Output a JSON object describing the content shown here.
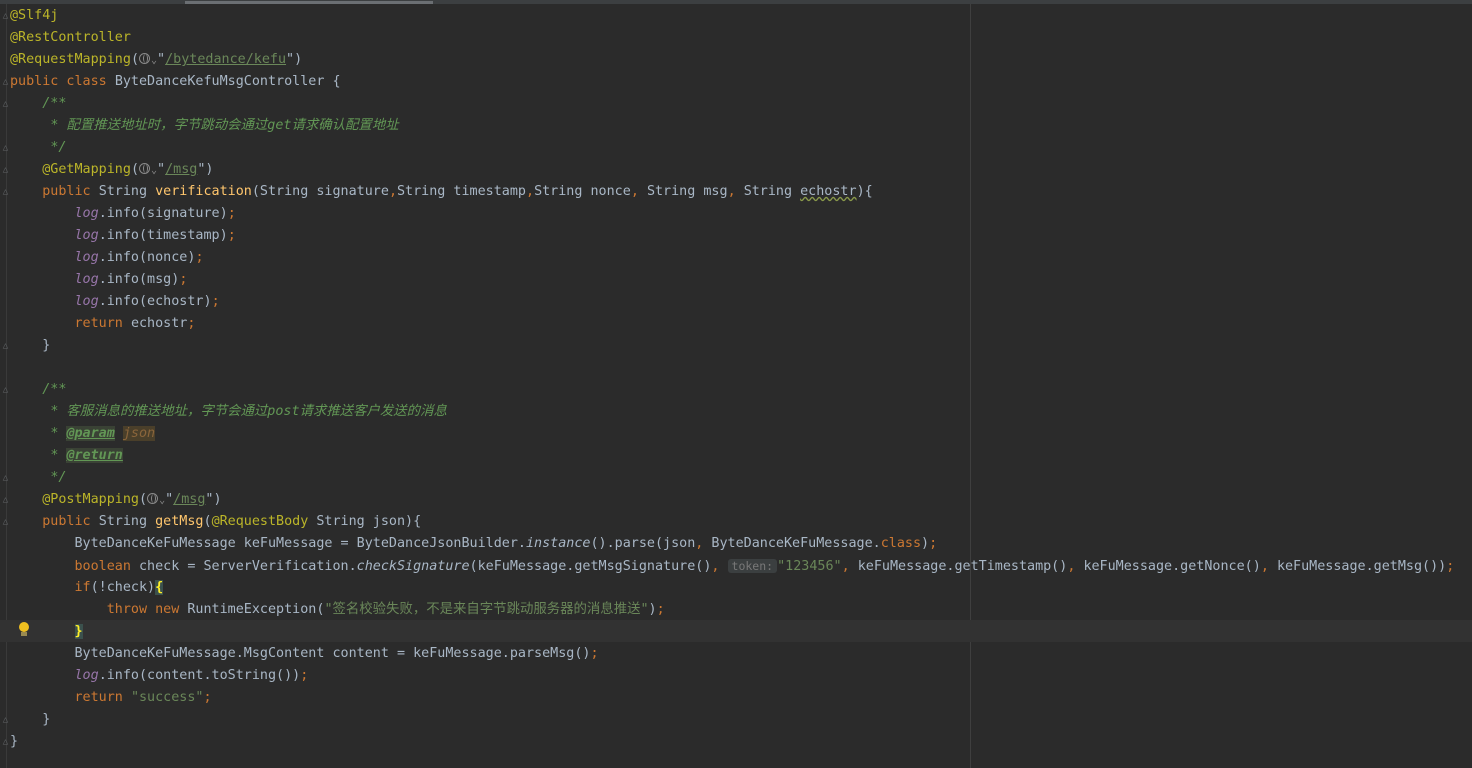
{
  "editor": {
    "lines": [
      [
        {
          "t": "@Slf4j",
          "c": "ann"
        }
      ],
      [
        {
          "t": "@RestController",
          "c": "ann"
        }
      ],
      [
        {
          "t": "@RequestMapping",
          "c": "ann"
        },
        {
          "t": "("
        },
        {
          "icon": "globe-icon"
        },
        {
          "t": "\""
        },
        {
          "t": "/bytedance/kefu",
          "c": "str url"
        },
        {
          "t": "\")"
        }
      ],
      [
        {
          "t": "public class ",
          "c": "kw"
        },
        {
          "t": "ByteDanceKefuMsgController {"
        }
      ],
      [
        {
          "t": "    "
        },
        {
          "t": "/**",
          "c": "doc"
        }
      ],
      [
        {
          "t": "     "
        },
        {
          "t": "* 配置推送地址时，字节跳动会通过",
          "c": "doc"
        },
        {
          "t": "get",
          "c": "doc"
        },
        {
          "t": "请求确认配置地址",
          "c": "doc"
        }
      ],
      [
        {
          "t": "     "
        },
        {
          "t": "*/",
          "c": "doc"
        }
      ],
      [
        {
          "t": "    "
        },
        {
          "t": "@GetMapping",
          "c": "ann"
        },
        {
          "t": "("
        },
        {
          "icon": "globe-icon"
        },
        {
          "t": "\""
        },
        {
          "t": "/msg",
          "c": "str url"
        },
        {
          "t": "\")"
        }
      ],
      [
        {
          "t": "    "
        },
        {
          "t": "public ",
          "c": "kw"
        },
        {
          "t": "String "
        },
        {
          "t": "verification",
          "c": "fn"
        },
        {
          "t": "(String signature"
        },
        {
          "t": ",",
          "c": "kw"
        },
        {
          "t": "String timestamp"
        },
        {
          "t": ",",
          "c": "kw"
        },
        {
          "t": "String nonce"
        },
        {
          "t": ", ",
          "c": "kw"
        },
        {
          "t": "String msg"
        },
        {
          "t": ", ",
          "c": "kw"
        },
        {
          "t": "String "
        },
        {
          "t": "echostr",
          "c": "squig"
        },
        {
          "t": "){"
        }
      ],
      [
        {
          "t": "        "
        },
        {
          "t": "log",
          "c": "field"
        },
        {
          "t": ".info(signature)"
        },
        {
          "t": ";",
          "c": "kw"
        }
      ],
      [
        {
          "t": "        "
        },
        {
          "t": "log",
          "c": "field"
        },
        {
          "t": ".info(timestamp)"
        },
        {
          "t": ";",
          "c": "kw"
        }
      ],
      [
        {
          "t": "        "
        },
        {
          "t": "log",
          "c": "field"
        },
        {
          "t": ".info(nonce)"
        },
        {
          "t": ";",
          "c": "kw"
        }
      ],
      [
        {
          "t": "        "
        },
        {
          "t": "log",
          "c": "field"
        },
        {
          "t": ".info(msg)"
        },
        {
          "t": ";",
          "c": "kw"
        }
      ],
      [
        {
          "t": "        "
        },
        {
          "t": "log",
          "c": "field"
        },
        {
          "t": ".info(echostr)"
        },
        {
          "t": ";",
          "c": "kw"
        }
      ],
      [
        {
          "t": "        "
        },
        {
          "t": "return ",
          "c": "kw"
        },
        {
          "t": "echostr"
        },
        {
          "t": ";",
          "c": "kw"
        }
      ],
      [
        {
          "t": "    }"
        }
      ],
      [],
      [
        {
          "t": "    "
        },
        {
          "t": "/**",
          "c": "doc"
        }
      ],
      [
        {
          "t": "     "
        },
        {
          "t": "* 客服消息的推送地址，字节会通过",
          "c": "doc"
        },
        {
          "t": "post",
          "c": "doc"
        },
        {
          "t": "请求推送客户发送的消息",
          "c": "doc"
        }
      ],
      [
        {
          "t": "     "
        },
        {
          "t": "* ",
          "c": "doc"
        },
        {
          "t": "@param",
          "c": "doctag"
        },
        {
          "t": " "
        },
        {
          "t": "json",
          "c": "docparam"
        }
      ],
      [
        {
          "t": "     "
        },
        {
          "t": "* ",
          "c": "doc"
        },
        {
          "t": "@return",
          "c": "doctag"
        }
      ],
      [
        {
          "t": "     "
        },
        {
          "t": "*/",
          "c": "doc"
        }
      ],
      [
        {
          "t": "    "
        },
        {
          "t": "@PostMapping",
          "c": "ann"
        },
        {
          "t": "("
        },
        {
          "icon": "globe-icon"
        },
        {
          "t": "\""
        },
        {
          "t": "/msg",
          "c": "str url"
        },
        {
          "t": "\")"
        }
      ],
      [
        {
          "t": "    "
        },
        {
          "t": "public ",
          "c": "kw"
        },
        {
          "t": "String "
        },
        {
          "t": "getMsg",
          "c": "fn"
        },
        {
          "t": "("
        },
        {
          "t": "@RequestBody ",
          "c": "ann"
        },
        {
          "t": "String json){"
        }
      ],
      [
        {
          "t": "        ByteDanceKeFuMessage keFuMessage = ByteDanceJsonBuilder."
        },
        {
          "t": "instance",
          "c": "italic"
        },
        {
          "t": "().parse(json"
        },
        {
          "t": ", ",
          "c": "kw"
        },
        {
          "t": "ByteDanceKeFuMessage."
        },
        {
          "t": "class",
          "c": "kw"
        },
        {
          "t": ")"
        },
        {
          "t": ";",
          "c": "kw"
        }
      ],
      [
        {
          "t": "        "
        },
        {
          "t": "boolean ",
          "c": "kw"
        },
        {
          "t": "check = ServerVerification."
        },
        {
          "t": "checkSignature",
          "c": "italic"
        },
        {
          "t": "(keFuMessage.getMsgSignature()"
        },
        {
          "t": ", ",
          "c": "kw"
        },
        {
          "hint": "token:"
        },
        {
          "t": "\"123456\"",
          "c": "str"
        },
        {
          "t": ", ",
          "c": "kw"
        },
        {
          "t": "keFuMessage.getTimestamp()"
        },
        {
          "t": ", ",
          "c": "kw"
        },
        {
          "t": "keFuMessage.getNonce()"
        },
        {
          "t": ", ",
          "c": "kw"
        },
        {
          "t": "keFuMessage.getMsg())"
        },
        {
          "t": ";",
          "c": "kw"
        }
      ],
      [
        {
          "t": "        "
        },
        {
          "t": "if",
          "c": "kw"
        },
        {
          "t": "(!check)"
        },
        {
          "t": "{",
          "c": "brace-hl"
        }
      ],
      [
        {
          "t": "            "
        },
        {
          "t": "throw new ",
          "c": "kw"
        },
        {
          "t": "RuntimeException("
        },
        {
          "t": "\"签名校验失败，不是来自字节跳动服务器的消息推送\"",
          "c": "str"
        },
        {
          "t": ")"
        },
        {
          "t": ";",
          "c": "kw"
        }
      ],
      [
        {
          "t": "        "
        },
        {
          "t": "}",
          "c": "brace-hl"
        }
      ],
      [
        {
          "t": "        ByteDanceKeFuMessage.MsgContent content = keFuMessage.parseMsg()"
        },
        {
          "t": ";",
          "c": "kw"
        }
      ],
      [
        {
          "t": "        "
        },
        {
          "t": "log",
          "c": "field"
        },
        {
          "t": ".info(content.toString())"
        },
        {
          "t": ";",
          "c": "kw"
        }
      ],
      [
        {
          "t": "        "
        },
        {
          "t": "return ",
          "c": "kw"
        },
        {
          "t": "\"success\"",
          "c": "str"
        },
        {
          "t": ";",
          "c": "kw"
        }
      ],
      [
        {
          "t": "    }"
        }
      ],
      [
        {
          "t": "}"
        }
      ]
    ]
  }
}
